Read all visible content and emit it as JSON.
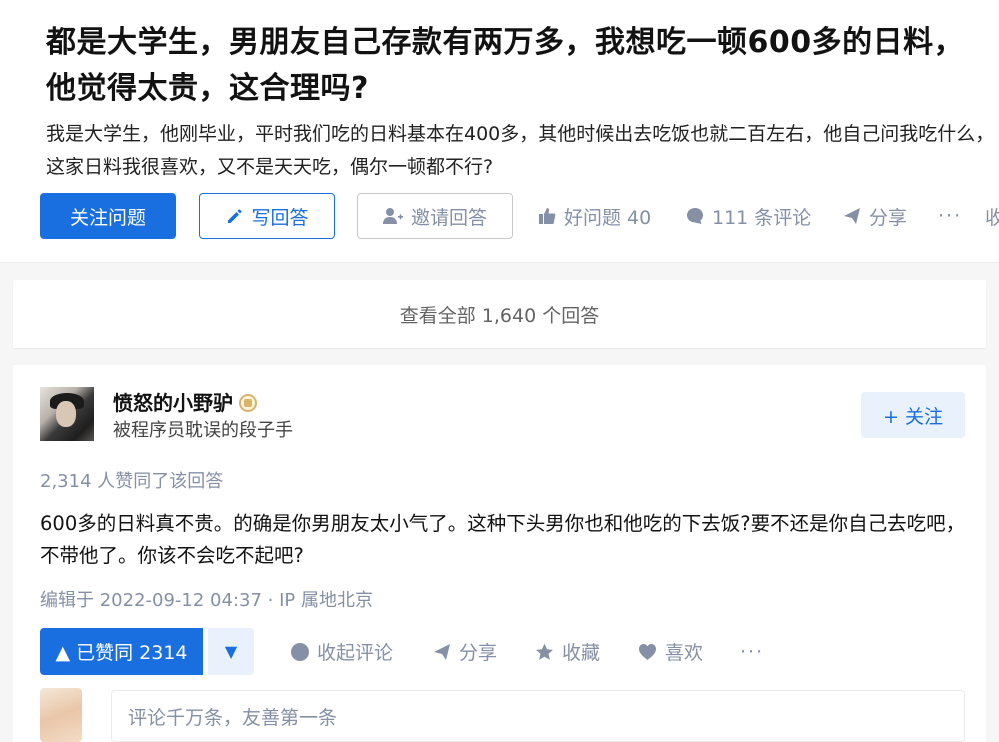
{
  "question": {
    "title": "都是大学生，男朋友自己存款有两万多，我想吃一顿600多的日料，他觉得太贵，这合理吗?",
    "description": "我是大学生，他刚毕业，平时我们吃的日料基本在400多，其他时候出去吃饭也就二百左右，他自己问我吃什么，这家日料我很喜欢，又不是天天吃，偶尔一顿都不行?",
    "actions": {
      "follow_label": "关注问题",
      "write_label": "写回答",
      "invite_label": "邀请回答",
      "good_question": "好问题 40",
      "comments": "111 条评论",
      "share": "分享",
      "more": "···",
      "collapse": "收"
    }
  },
  "view_all": "查看全部 1,640 个回答",
  "answer": {
    "author_name": "愤怒的小野驴",
    "author_bio": "被程序员耽误的段子手",
    "follow_label": "+ 关注",
    "upvote_summary": "2,314 人赞同了该回答",
    "content": "600多的日料真不贵。的确是你男朋友太小气了。这种下头男你也和他吃的下去饭?要不还是你自己去吃吧，不带他了。你该不会吃不起吧?",
    "edit_info": "编辑于 2022-09-12 04:37 · IP 属地北京",
    "voted_label": "▲ 已赞同 2314",
    "downvote_symbol": "▼",
    "collapse_comments": "收起评论",
    "share": "分享",
    "collect": "收藏",
    "like": "喜欢",
    "more": "···",
    "comment_placeholder": "评论千万条，友善第一条"
  },
  "colors": {
    "accent": "#1a6fe0",
    "muted": "#8590a6",
    "background": "#f6f6f6"
  },
  "icons": [
    "pencil-icon",
    "invite-user-icon",
    "thumbs-up-icon",
    "comment-icon",
    "share-icon",
    "gold-badge-icon",
    "plus-icon",
    "collect-star-icon",
    "heart-icon"
  ]
}
